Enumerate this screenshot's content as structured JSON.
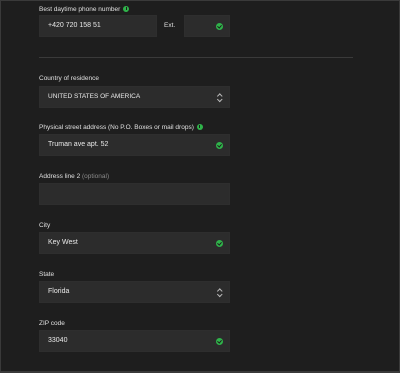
{
  "phone": {
    "label": "Best daytime phone number",
    "value": "+420 720 158 51",
    "ext_label": "Ext.",
    "ext_value": ""
  },
  "country": {
    "label": "Country of residence",
    "value": "UNITED STATES OF AMERICA"
  },
  "street": {
    "label": "Physical street address (No P.O. Boxes or mail drops)",
    "value": "Truman ave apt. 52"
  },
  "address2": {
    "label": "Address line 2",
    "optional": "(optional)",
    "value": ""
  },
  "city": {
    "label": "City",
    "value": "Key West"
  },
  "state": {
    "label": "State",
    "value": "Florida"
  },
  "zip": {
    "label": "ZIP code",
    "value": "33040"
  },
  "colors": {
    "background": "#1e1e1e",
    "field": "#2c2c2c",
    "valid": "#2fb34a"
  },
  "icons": {
    "valid": "check-circle-icon",
    "info": "info-icon",
    "select": "up-down-chevron-icon"
  }
}
